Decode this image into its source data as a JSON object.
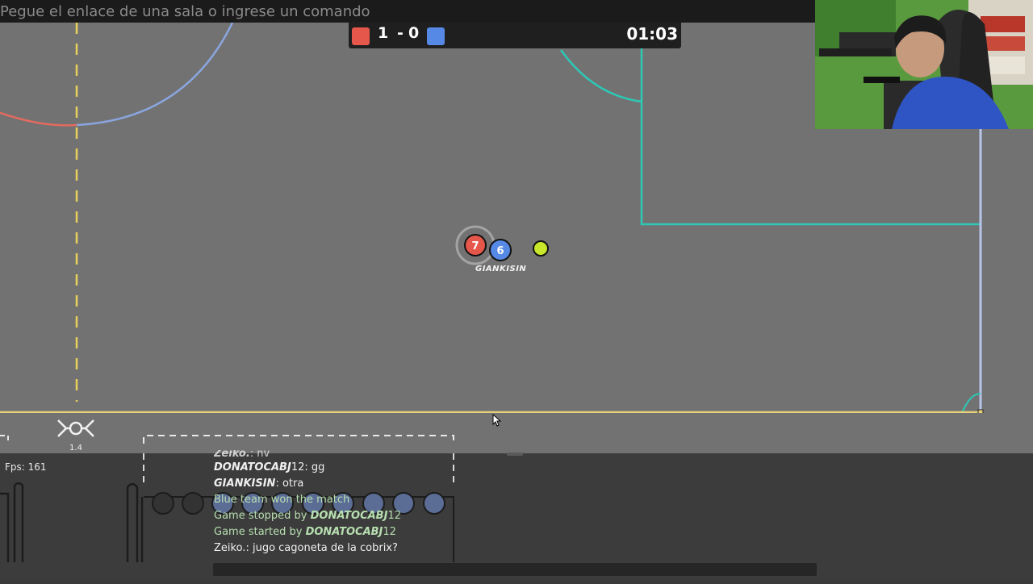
{
  "command_bar": {
    "placeholder": "Pegue el enlace de una sala o ingrese un comando"
  },
  "scoreboard": {
    "red_score": "1",
    "separator": "-",
    "blue_score": "0",
    "timer": "01:03",
    "colors": {
      "red": "#e5564b",
      "blue": "#5689e5"
    }
  },
  "players": [
    {
      "number": "7",
      "team": "red",
      "color": "#e5564b"
    },
    {
      "number": "6",
      "team": "blue",
      "color": "#5689e5",
      "name": "GIANKISIN"
    }
  ],
  "ball": {
    "color": "#c8e62a"
  },
  "minimap_label": "1.4",
  "fps": "Fps: 161",
  "chat": [
    {
      "name": "Zeiko.",
      "text": ": nv",
      "cut": true
    },
    {
      "name": "DONATOCABJ",
      "suffix": "12",
      "text": ": gg"
    },
    {
      "name": "GIANKISIN",
      "text": ": otra"
    },
    {
      "system": "Blue team won the match"
    },
    {
      "prefix": "Game stopped by ",
      "name": "DONATOCABJ",
      "suffix": "12"
    },
    {
      "prefix": "Game started by ",
      "name": "DONATOCABJ",
      "suffix": "12"
    },
    {
      "name": "Zeiko.",
      "plain_name": true,
      "text": ": jugo cagoneta de la cobrix?"
    }
  ]
}
